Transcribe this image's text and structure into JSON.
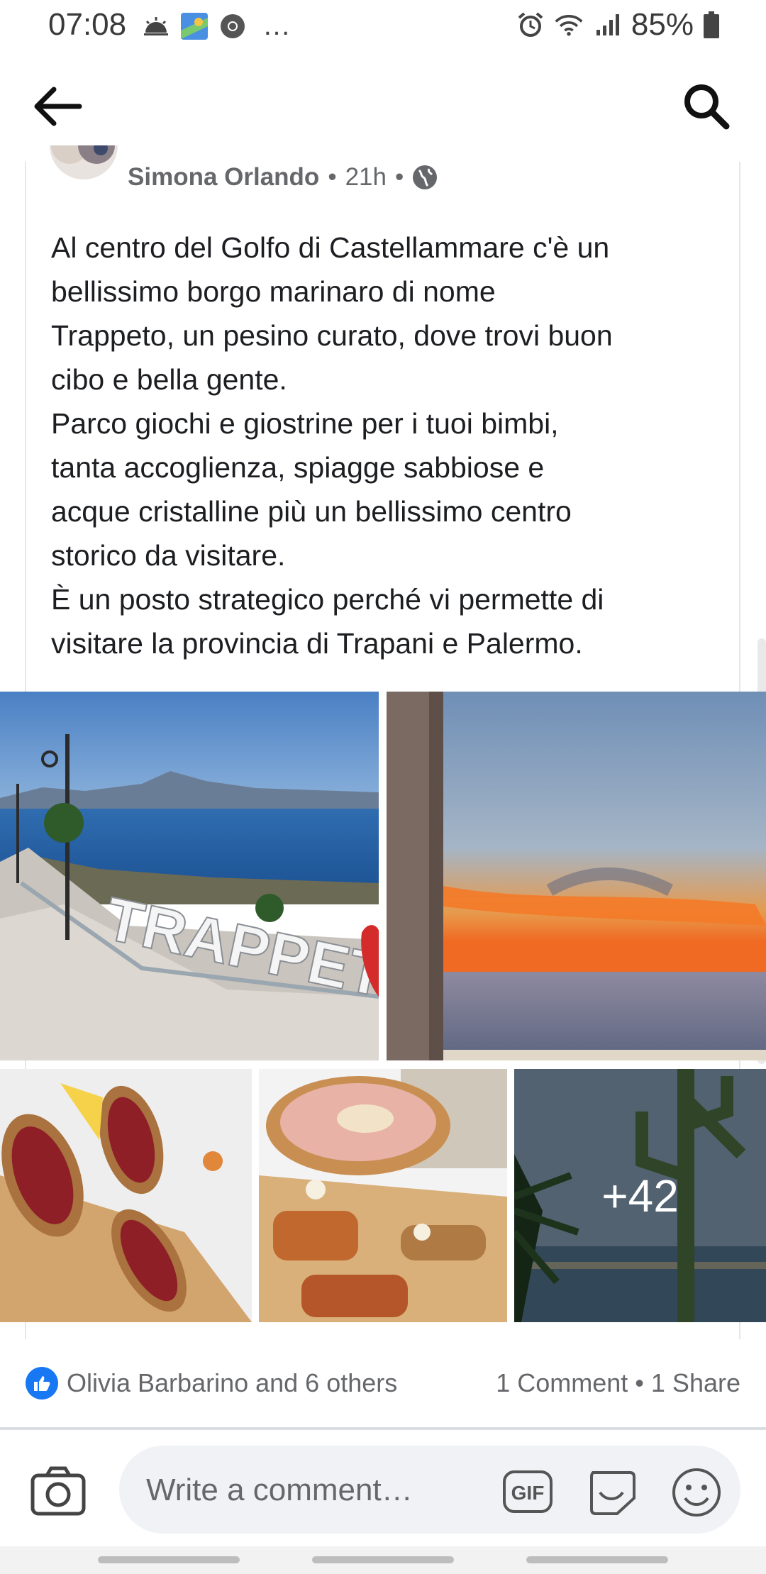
{
  "status_bar": {
    "time": "07:08",
    "battery": "85%",
    "overflow": "…"
  },
  "post": {
    "author": "Simona Orlando",
    "time": "21h",
    "separator": "•",
    "text": "Al centro del Golfo di Castellammare c'è un\nbellissimo borgo marinaro di nome\nTrappeto, un pesino curato, dove trovi buon\ncibo e bella gente.\nParco giochi e giostrine per i tuoi bimbi,\ntanta accoglienza, spiagge sabbiose e\nacque cristalline più un bellissimo centro\nstorico da visitare.\nÈ un posto strategico perché vi permette di\nvisitare la provincia di Trapani e Palermo.",
    "photo_sign_text": "TRAPPET",
    "more_photos": "+42",
    "reactions_text": "Olivia Barbarino and 6 others",
    "counts_text": "1 Comment • 1 Share"
  },
  "comment_bar": {
    "placeholder": "Write a comment…",
    "gif_label": "GIF"
  },
  "icons": [
    "back-arrow-icon",
    "search-icon",
    "globe-icon",
    "like-icon",
    "camera-icon",
    "gif-icon",
    "sticker-icon",
    "emoji-icon",
    "alarm-icon",
    "wifi-icon",
    "signal-icon",
    "battery-icon"
  ],
  "colors": {
    "like_blue": "#1877f2",
    "secondary_text": "#65676b",
    "input_bg": "#f0f2f5"
  }
}
